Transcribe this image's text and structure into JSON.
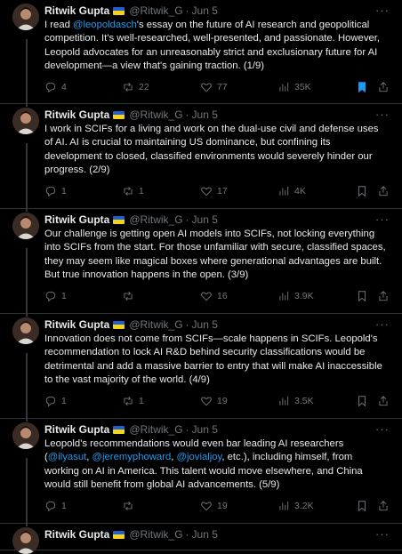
{
  "author": {
    "name": "Ritwik Gupta",
    "handle": "@Ritwik_G",
    "date": "Jun 5"
  },
  "colors": {
    "accent": "#1d9bf0",
    "muted": "#71767b",
    "flag_top": "#1f5fd1",
    "flag_bottom": "#f6d21b"
  },
  "posts": [
    {
      "t1": "I read ",
      "m1": "@leopoldasch",
      "t2": "'s essay on the future of AI research and geopolitical competition. It's well-researched, well-presented, and passionate. However, Leopold advocates for an unreasonably strict and exclusionary future for AI development—a view that's gaining traction. (1/9)",
      "replies": "4",
      "reposts": "22",
      "likes": "77",
      "views": "35K",
      "bookmarked": true
    },
    {
      "t1": "I work in SCIFs for a living and work on the dual-use civil and defense uses of AI. AI is crucial to maintaining US dominance, but confining its development to closed, classified environments would severely hinder our progress. (2/9)",
      "replies": "1",
      "reposts": "1",
      "likes": "17",
      "views": "4K",
      "bookmarked": false
    },
    {
      "t1": "Our challenge is getting open AI models into SCIFs, not locking everything into SCIFs from the start. For those unfamiliar with secure, classified spaces, they may seem like magical boxes where generational advantages are built. But true innovation happens in the open. (3/9)",
      "replies": "1",
      "reposts": "",
      "likes": "16",
      "views": "3.9K",
      "bookmarked": false
    },
    {
      "t1": "Innovation does not come from SCIFs—scale happens in SCIFs. Leopold's recommendation to lock AI R&D behind security classifications would be detrimental and add a massive barrier to entry that will make AI inaccessible to the vast majority of the world. (4/9)",
      "replies": "1",
      "reposts": "1",
      "likes": "19",
      "views": "3.5K",
      "bookmarked": false
    },
    {
      "t1": "Leopold's recommendations would even bar leading AI researchers (",
      "m1": "@ilyasut",
      "t2": ", ",
      "m2": "@jeremyphoward",
      "t3": ", ",
      "m3": "@jovialjoy",
      "t4": ", etc.), including himself, from working on AI in America. This talent would move elsewhere, and China would still benefit from global AI advancements. (5/9)",
      "replies": "1",
      "reposts": "",
      "likes": "19",
      "views": "3.2K",
      "bookmarked": false
    }
  ]
}
